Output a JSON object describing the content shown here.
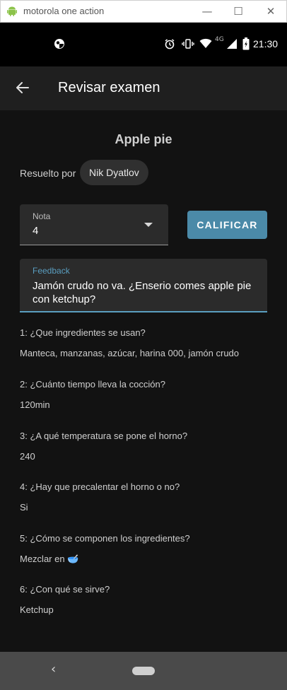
{
  "window": {
    "title": "motorola one action",
    "controls": {
      "minimize": "—",
      "maximize": "☐",
      "close": "✕"
    }
  },
  "status_bar": {
    "time": "21:30",
    "network": "4G",
    "icons": [
      "alarm-icon",
      "vibrate-icon",
      "wifi-icon",
      "signal-icon",
      "battery-icon"
    ]
  },
  "app_bar": {
    "title": "Revisar examen",
    "back_icon": "arrow-back-icon"
  },
  "exam": {
    "title": "Apple pie",
    "resolved_by_label": "Resuelto por",
    "resolved_by_name": "Nik Dyatlov"
  },
  "grade": {
    "label": "Nota",
    "value": "4"
  },
  "grade_button_label": "CALIFICAR",
  "feedback": {
    "label": "Feedback",
    "value": "Jamón crudo no va. ¿Enserio comes apple pie con ketchup?"
  },
  "questions": [
    {
      "question": "1: ¿Que ingredientes se usan?",
      "answer": "Manteca, manzanas, azúcar, harina 000, jamón crudo"
    },
    {
      "question": "2: ¿Cuánto tiempo lleva la cocción?",
      "answer": "120min"
    },
    {
      "question": "3: ¿A qué temperatura se pone el horno?",
      "answer": "240"
    },
    {
      "question": "4: ¿Hay que precalentar el horno o no?",
      "answer": "Si"
    },
    {
      "question": "5: ¿Cómo se componen los ingredientes?",
      "answer": "Mezclar en 🥣"
    },
    {
      "question": "6: ¿Con qué se sirve?",
      "answer": "Ketchup"
    }
  ],
  "colors": {
    "background": "#121212",
    "app_bar": "#1f1f1f",
    "accent": "#4b8aa8",
    "field_focus": "#5a9ec0",
    "nav_bar": "#4a4a4a"
  }
}
